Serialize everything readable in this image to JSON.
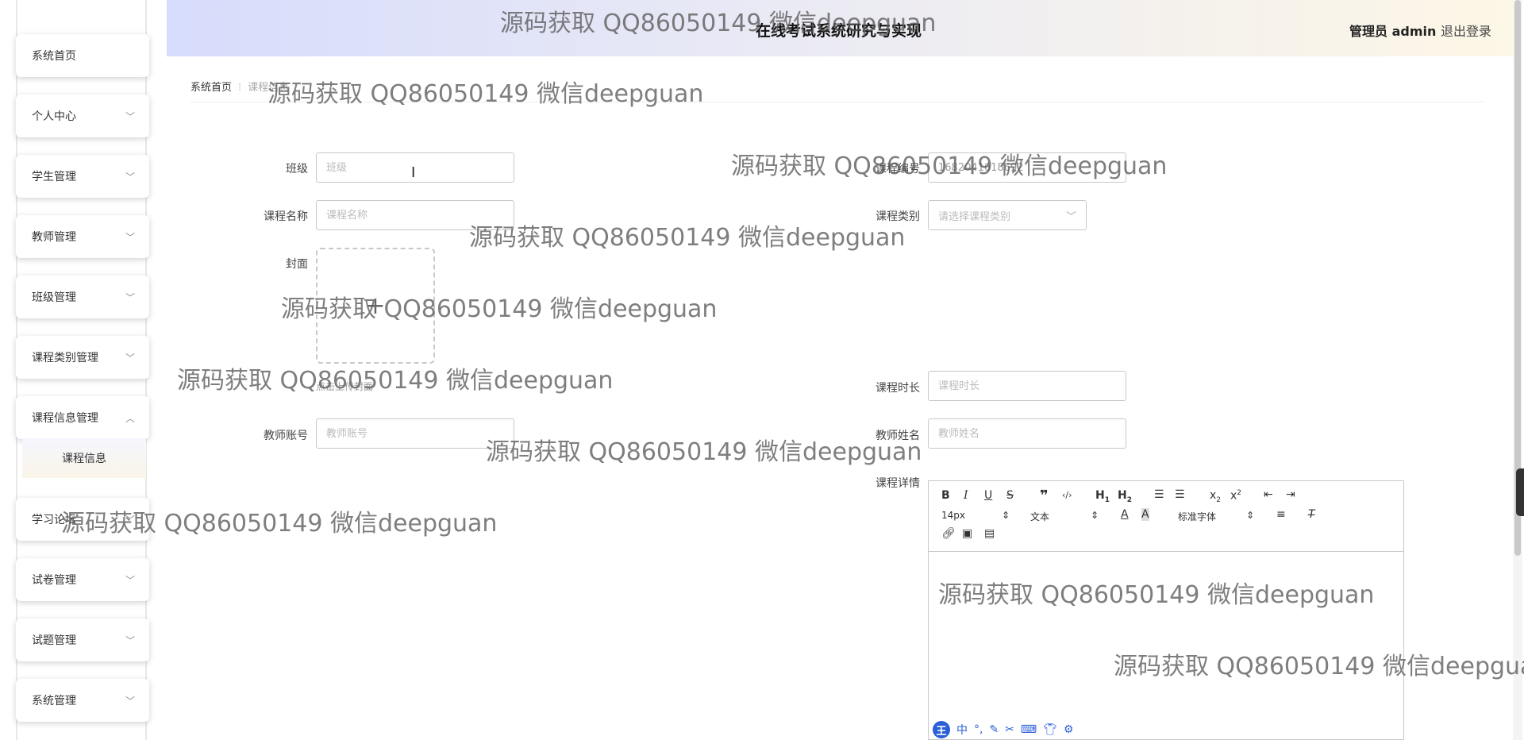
{
  "header": {
    "title": "在线考试系统研究与实现",
    "user_role": "管理员 admin",
    "logout": "退出登录"
  },
  "sidebar": {
    "items": [
      {
        "label": "系统首页"
      },
      {
        "label": "个人中心"
      },
      {
        "label": "学生管理"
      },
      {
        "label": "教师管理"
      },
      {
        "label": "班级管理"
      },
      {
        "label": "课程类别管理"
      },
      {
        "label": "课程信息管理"
      },
      {
        "label": "学习论坛"
      },
      {
        "label": "试卷管理"
      },
      {
        "label": "试题管理"
      },
      {
        "label": "系统管理"
      }
    ],
    "submenu": {
      "label": "课程信息"
    }
  },
  "breadcrumb": {
    "home": "系统首页",
    "current": "课程信息"
  },
  "form": {
    "class_label": "班级",
    "class_placeholder": "班级",
    "course_no_label": "课程编号",
    "course_no_value": "1682041618692",
    "course_name_label": "课程名称",
    "course_name_placeholder": "课程名称",
    "course_type_label": "课程类别",
    "course_type_placeholder": "请选择课程类别",
    "cover_label": "封面",
    "upload_hint": "点击上传封面",
    "duration_label": "课程时长",
    "duration_placeholder": "课程时长",
    "teacher_account_label": "教师账号",
    "teacher_account_placeholder": "教师账号",
    "teacher_name_label": "教师姓名",
    "teacher_name_placeholder": "教师姓名",
    "detail_label": "课程详情"
  },
  "editor": {
    "font_size": "14px",
    "block_type": "文本",
    "font_family": "标准字体"
  },
  "ime": {
    "logo": "王",
    "mode": "中"
  },
  "watermark": "源码获取 QQ86050149 微信deepguan",
  "colors": {
    "header_start": "#d6dcfb",
    "header_end": "#fdf7e6",
    "ime_blue": "#2a5fd8"
  }
}
